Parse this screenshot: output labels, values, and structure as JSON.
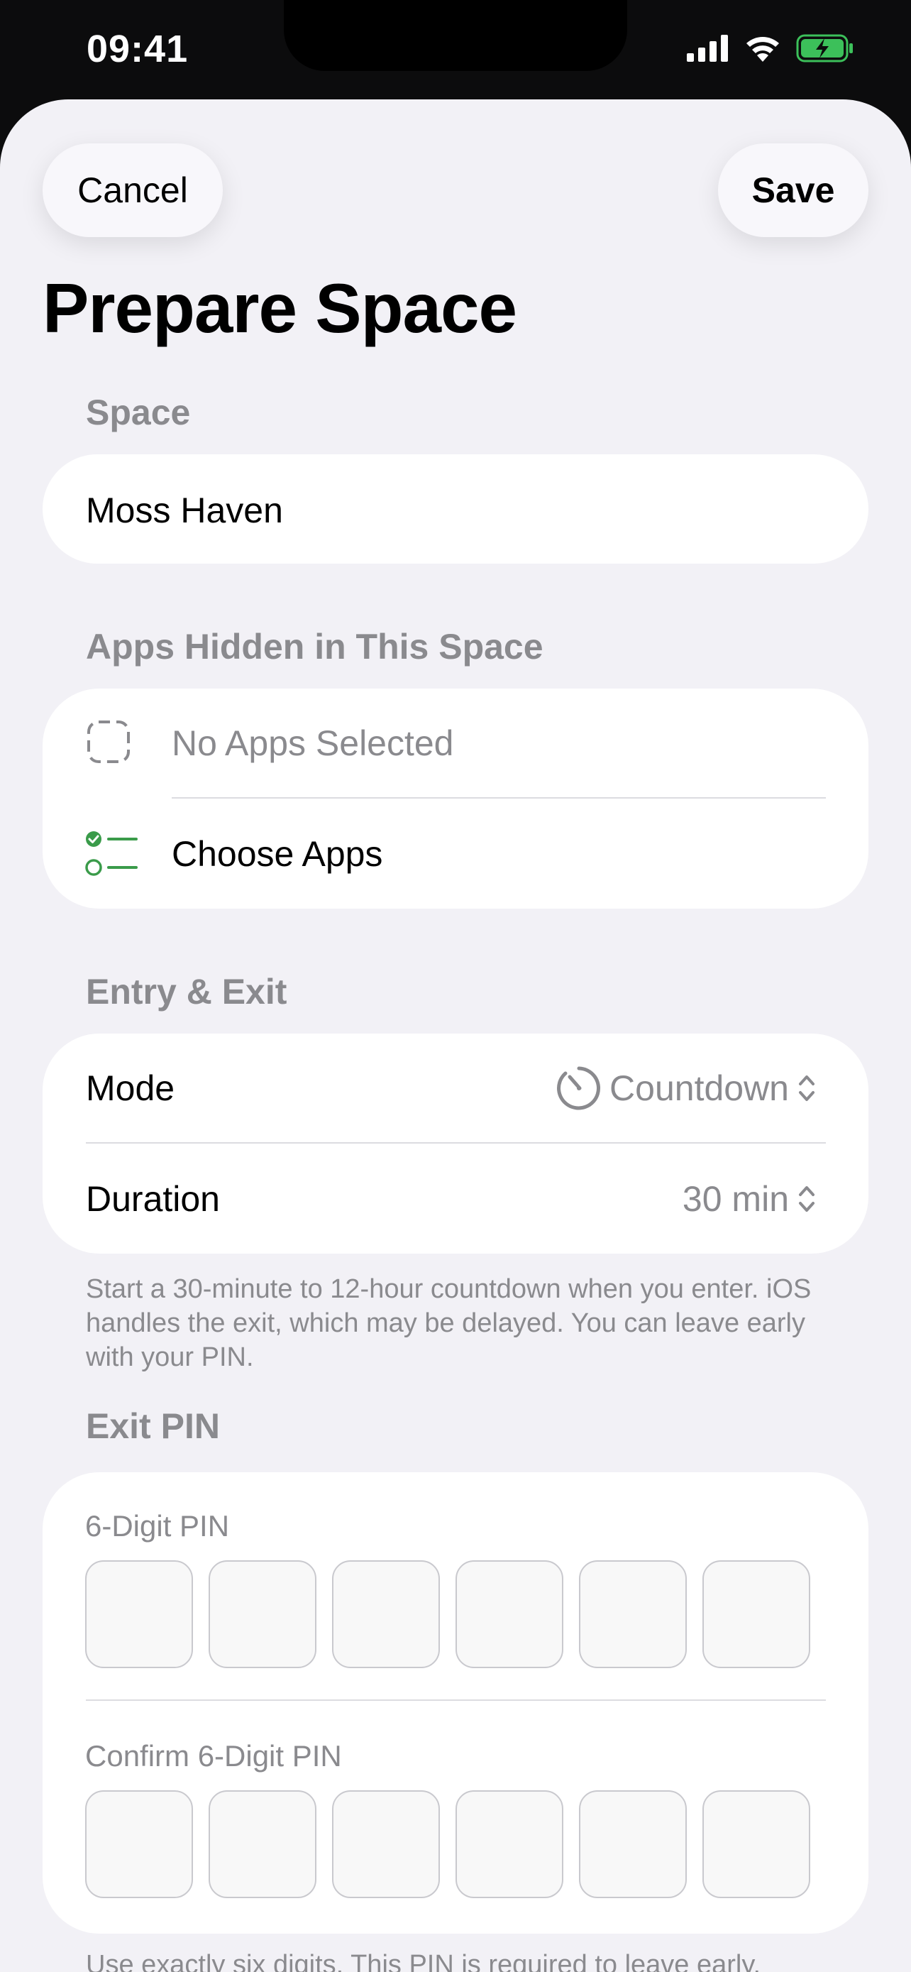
{
  "status_bar": {
    "time": "09:41"
  },
  "nav": {
    "cancel_label": "Cancel",
    "save_label": "Save"
  },
  "page_title": "Prepare Space",
  "space_section": {
    "header": "Space",
    "name_value": "Moss Haven"
  },
  "apps_section": {
    "header": "Apps Hidden in This Space",
    "empty_label": "No Apps Selected",
    "choose_label": "Choose Apps",
    "accent_color": "#3a9b4a"
  },
  "entry_exit_section": {
    "header": "Entry & Exit",
    "mode_label": "Mode",
    "mode_value": "Countdown",
    "duration_label": "Duration",
    "duration_value": "30 min",
    "footnote": "Start a 30-minute to 12-hour countdown when you enter. iOS handles the exit, which may be delayed. You can leave early with your PIN."
  },
  "pin_section": {
    "header": "Exit PIN",
    "pin_label": "6-Digit PIN",
    "confirm_label": "Confirm 6-Digit PIN",
    "footnote_partial": "Use exactly six digits. This PIN is required to leave early."
  },
  "icons": {
    "signal": "cellular-signal-icon",
    "wifi": "wifi-icon",
    "battery": "battery-charging-icon",
    "no_apps": "dashed-square-icon",
    "choose_apps": "checklist-icon",
    "mode": "timer-icon",
    "stepper": "chevron-up-down-icon"
  }
}
